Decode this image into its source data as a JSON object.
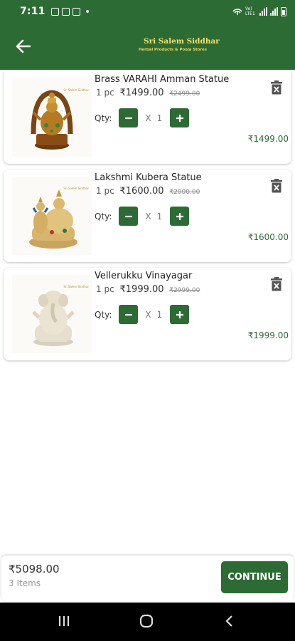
{
  "status_bar": {
    "time": "7:11",
    "network_label": "Vo) LTE1"
  },
  "app_bar": {
    "logo": {
      "prefix": "Sri",
      "name": "Sri Salem Siddhar",
      "tagline": "Herbal Products & Pooja Stores"
    }
  },
  "cart": {
    "qty_label": "Qty:",
    "times_symbol": "X",
    "items": [
      {
        "title": "Brass VARAHI Amman Statue",
        "unit": "1 pc",
        "price": "₹1499.00",
        "mrp": "₹2499.00",
        "quantity": "1",
        "line_total": "₹1499.00",
        "thumb_tag": "Sri Salem Siddhar"
      },
      {
        "title": "Lakshmi Kubera Statue",
        "unit": "1 pc",
        "price": "₹1600.00",
        "mrp": "₹2000.00",
        "quantity": "1",
        "line_total": "₹1600.00",
        "thumb_tag": "Sri Salem Siddhar"
      },
      {
        "title": "Vellerukku Vinayagar",
        "unit": "1 pc",
        "price": "₹1999.00",
        "mrp": "₹2999.00",
        "quantity": "1",
        "line_total": "₹1999.00",
        "thumb_tag": "Sri Salem Siddhar"
      }
    ]
  },
  "footer": {
    "total": "₹5098.00",
    "item_count": "3 Items",
    "continue_label": "CONTINUE"
  },
  "colors": {
    "primary": "#2d6b35",
    "logo_gold": "#f2e06a"
  }
}
